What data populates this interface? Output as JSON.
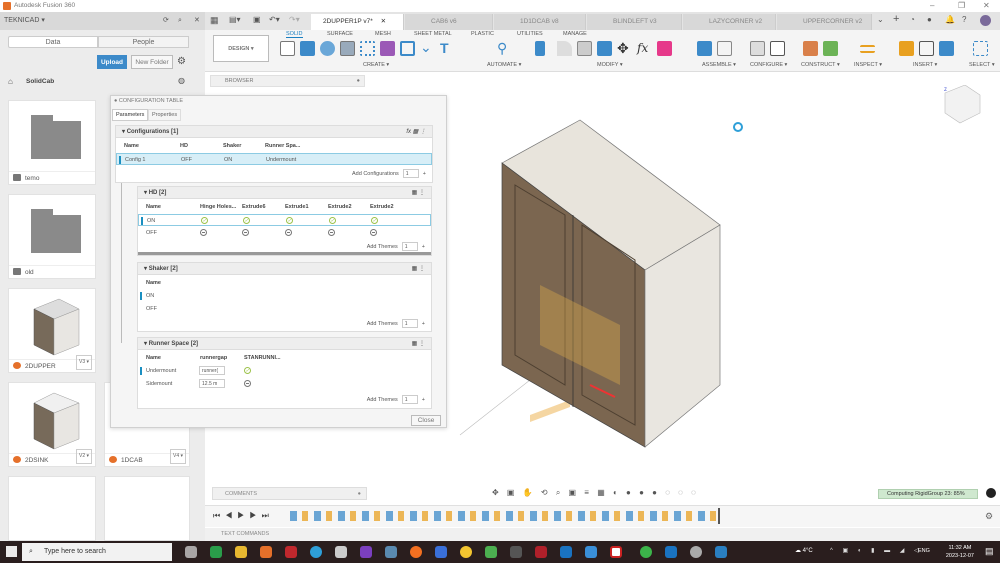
{
  "app": {
    "title": "Autodesk Fusion 360"
  },
  "left_panel": {
    "team": "TEKNICAD ▾",
    "tabs": [
      "Data",
      "People"
    ],
    "upload": "Upload",
    "new_folder": "New Folder",
    "breadcrumb": "SolidCab",
    "items": [
      {
        "name": "temo",
        "type": "folder"
      },
      {
        "name": "old",
        "type": "folder"
      },
      {
        "name": "2DUPPER",
        "version": "V3 ▾"
      },
      {
        "name": "2DSINK",
        "version": "V2 ▾"
      },
      {
        "name": "1DCAB",
        "version": "V4 ▾"
      }
    ]
  },
  "doc_tabs": [
    {
      "label": "2DUPPER1P v7*",
      "active": true
    },
    {
      "label": "CAB6 v6"
    },
    {
      "label": "1D1DCAB v8"
    },
    {
      "label": "BLINDLEFT v3"
    },
    {
      "label": "LAZYCORNER v2"
    },
    {
      "label": "UPPERCORNER v2"
    }
  ],
  "toolbar": {
    "workspace": "DESIGN ▾",
    "tabs": [
      "SOLID",
      "SURFACE",
      "MESH",
      "SHEET METAL",
      "PLASTIC",
      "UTILITIES",
      "MANAGE"
    ],
    "groups": [
      "CREATE ▾",
      "AUTOMATE ▾",
      "MODIFY ▾",
      "ASSEMBLE ▾",
      "CONFIGURE ▾",
      "CONSTRUCT ▾",
      "INSPECT ▾",
      "INSERT ▾",
      "SELECT ▾"
    ]
  },
  "browser": {
    "label": "BROWSER"
  },
  "config_table": {
    "title": "CONFIGURATION TABLE",
    "tabs": [
      "Parameters",
      "Properties"
    ],
    "configurations": {
      "title": "Configurations [1]",
      "headers": [
        "Name",
        "HD",
        "Shaker",
        "Runner Spa..."
      ],
      "rows": [
        [
          "Config 1",
          "OFF",
          "ON",
          "Undermount"
        ]
      ],
      "add_label": "Add Configurations",
      "add_count": "1"
    },
    "hd": {
      "title": "HD [2]",
      "headers": [
        "Name",
        "Hinge Holes...",
        "Extrude6",
        "Extrude1",
        "Extrude2",
        "Extrude2"
      ],
      "rows": [
        {
          "name": "ON",
          "state": "check"
        },
        {
          "name": "OFF",
          "state": "suppress"
        }
      ],
      "add_label": "Add Themes",
      "add_count": "1"
    },
    "shaker": {
      "title": "Shaker [2]",
      "headers": [
        "Name"
      ],
      "rows": [
        "ON",
        "OFF"
      ],
      "add_label": "Add Themes",
      "add_count": "1"
    },
    "runner": {
      "title": "Runner Space [2]",
      "headers": [
        "Name",
        "runnergap",
        "STANRUNNI..."
      ],
      "rows": [
        {
          "name": "Undermount",
          "value": "runner("
        },
        {
          "name": "Sidemount",
          "value": "12.5 m"
        }
      ],
      "add_label": "Add Themes",
      "add_count": "1"
    },
    "close": "Close"
  },
  "bottom": {
    "comments": "COMMENTS",
    "status": "Computing RigidGroup 23: 85%",
    "text_commands": "TEXT COMMANDS"
  },
  "taskbar": {
    "search": "Type here to search",
    "weather": "4°C",
    "lang": "ENG",
    "time": "11:32 AM",
    "date": "2023-12-07"
  }
}
